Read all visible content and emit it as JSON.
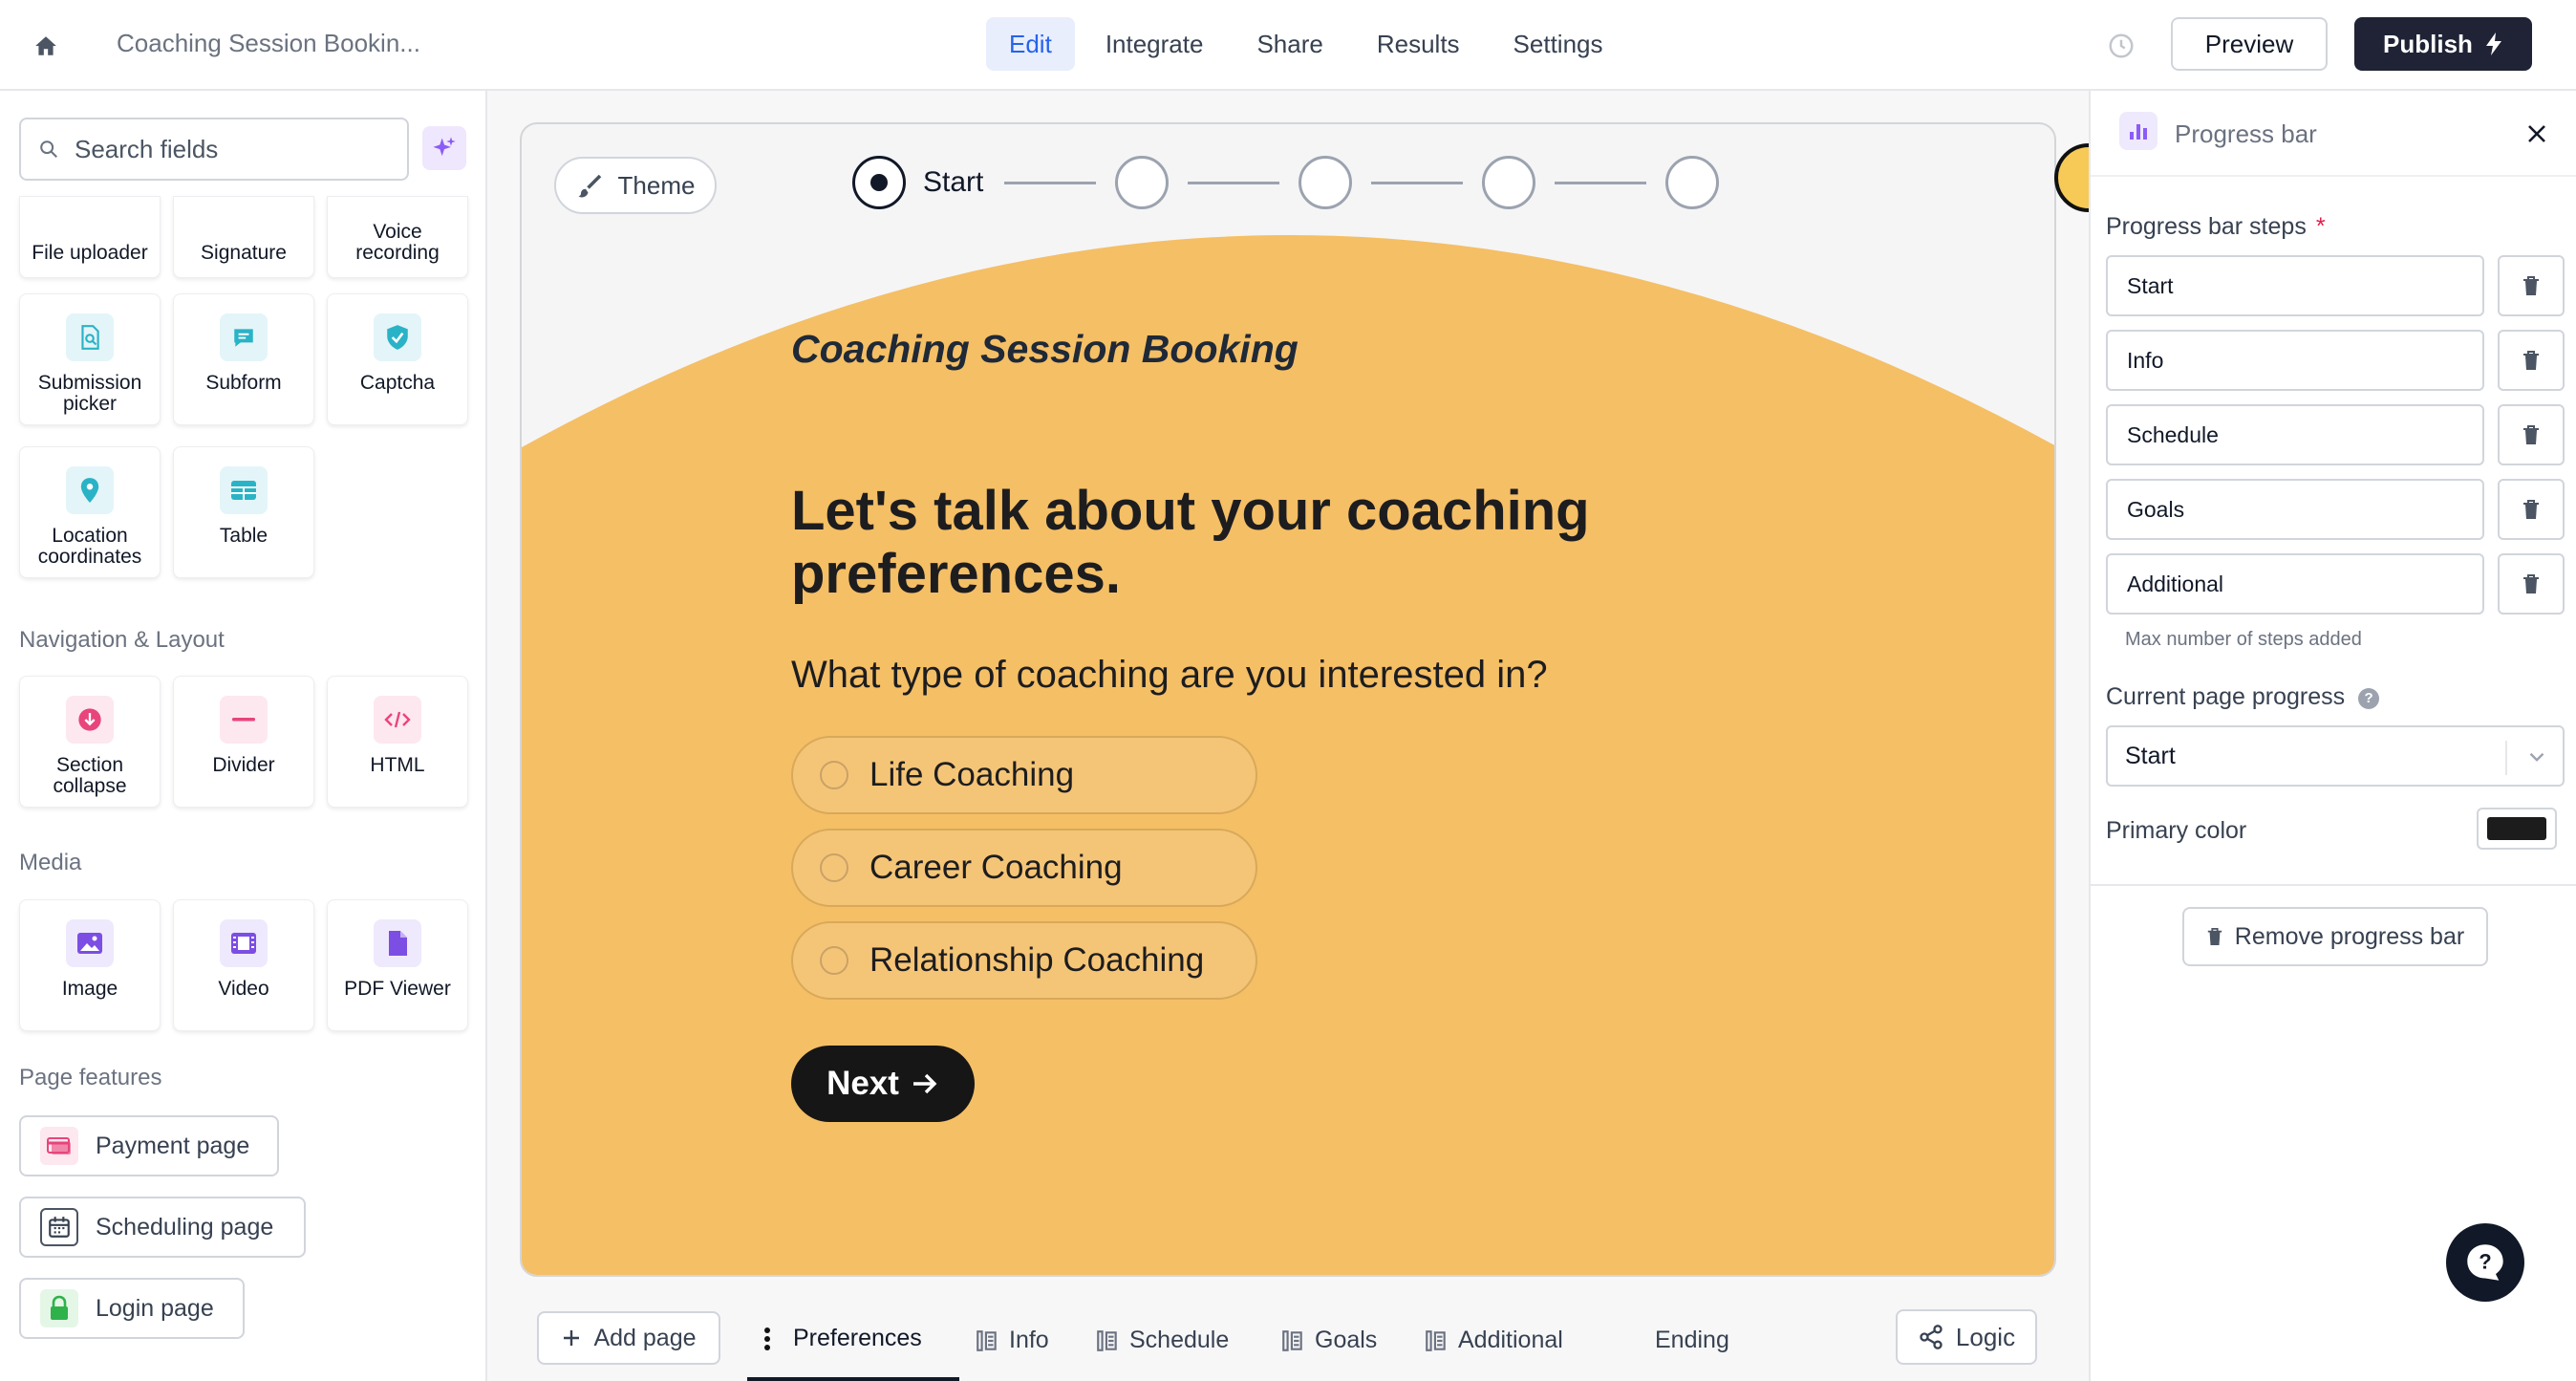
{
  "topbar": {
    "doc_title": "Coaching Session Bookin...",
    "nav": [
      "Edit",
      "Integrate",
      "Share",
      "Results",
      "Settings"
    ],
    "active_nav": "Edit",
    "preview_label": "Preview",
    "publish_label": "Publish"
  },
  "sidebar": {
    "search_placeholder": "Search fields",
    "partial_fields": [
      "File uploader",
      "Signature",
      "Voice recording"
    ],
    "fields_a": [
      "Submission picker",
      "Subform",
      "Captcha"
    ],
    "fields_b": [
      "Location coordinates",
      "Table"
    ],
    "nav_layout_title": "Navigation & Layout",
    "nav_layout_fields": [
      "Section collapse",
      "Divider",
      "HTML"
    ],
    "media_title": "Media",
    "media_fields": [
      "Image",
      "Video",
      "PDF Viewer"
    ],
    "page_features_title": "Page features",
    "page_features": [
      "Payment page",
      "Scheduling page",
      "Login page"
    ]
  },
  "canvas": {
    "theme_label": "Theme",
    "first_step_label": "Start",
    "step_count": 5,
    "form_title": "Coaching Session Booking",
    "heading": "Let's talk about your coaching preferences.",
    "question": "What type of coaching are you interested in?",
    "choices": [
      "Life Coaching",
      "Career Coaching",
      "Relationship Coaching"
    ],
    "next_label": "Next",
    "background_color": "#f5bf66"
  },
  "page_tabs": {
    "add_page_label": "Add page",
    "tabs": [
      "Preferences",
      "Info",
      "Schedule",
      "Goals",
      "Additional",
      "Ending"
    ],
    "active_tab": "Preferences",
    "logic_label": "Logic"
  },
  "right_panel": {
    "title": "Progress bar",
    "steps_label": "Progress bar steps",
    "steps": [
      "Start",
      "Info",
      "Schedule",
      "Goals",
      "Additional"
    ],
    "max_hint": "Max number of steps added",
    "current_progress_label": "Current page progress",
    "current_progress_value": "Start",
    "primary_color_label": "Primary color",
    "primary_color": "#1c1c1c",
    "remove_label": "Remove progress bar"
  }
}
